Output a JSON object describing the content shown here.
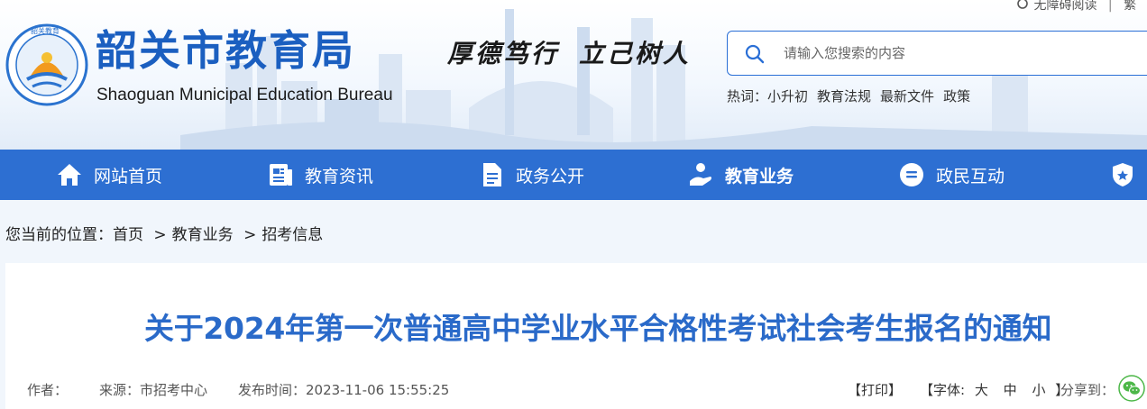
{
  "topbar": {
    "accessibility": "无障碍阅读",
    "divider": "|",
    "next": "繁"
  },
  "header": {
    "emblem_text": "韶关教育",
    "site_title": "韶关市教育局",
    "site_subtitle": "Shaoguan Municipal Education Bureau",
    "slogan_left": "厚德笃行",
    "slogan_right": "立己树人"
  },
  "search": {
    "placeholder": "请输入您搜索的内容",
    "icon": "search-icon"
  },
  "hot": {
    "label": "热词：",
    "words": [
      "小升初",
      "教育法规",
      "最新文件",
      "政策"
    ]
  },
  "nav": {
    "items": [
      {
        "label": "网站首页",
        "icon": "home-icon"
      },
      {
        "label": "教育资讯",
        "icon": "news-icon"
      },
      {
        "label": "政务公开",
        "icon": "document-icon"
      },
      {
        "label": "教育业务",
        "icon": "service-icon",
        "active": true
      },
      {
        "label": "政民互动",
        "icon": "chat-icon"
      },
      {
        "label": "",
        "icon": "shield-icon"
      }
    ]
  },
  "breadcrumb": {
    "prefix": "您当前的位置：",
    "items": [
      "首页",
      "教育业务",
      "招考信息"
    ],
    "separator": ">"
  },
  "article": {
    "title": "关于2024年第一次普通高中学业水平合格性考试社会考生报名的通知",
    "author_label": "作者：",
    "source": "来源：市招考中心",
    "published": "发布时间：2023-11-06 15:55:25",
    "print": "【打印】",
    "font_label": "【字体:",
    "font_large": "大",
    "font_medium": "中",
    "font_small": "小",
    "font_close": "】",
    "share_label": "分享到："
  },
  "colors": {
    "brand_blue": "#1b5fc0",
    "nav_blue": "#2d6fd2",
    "title_blue": "#2a6ac9",
    "wechat_green": "#4cb748"
  }
}
